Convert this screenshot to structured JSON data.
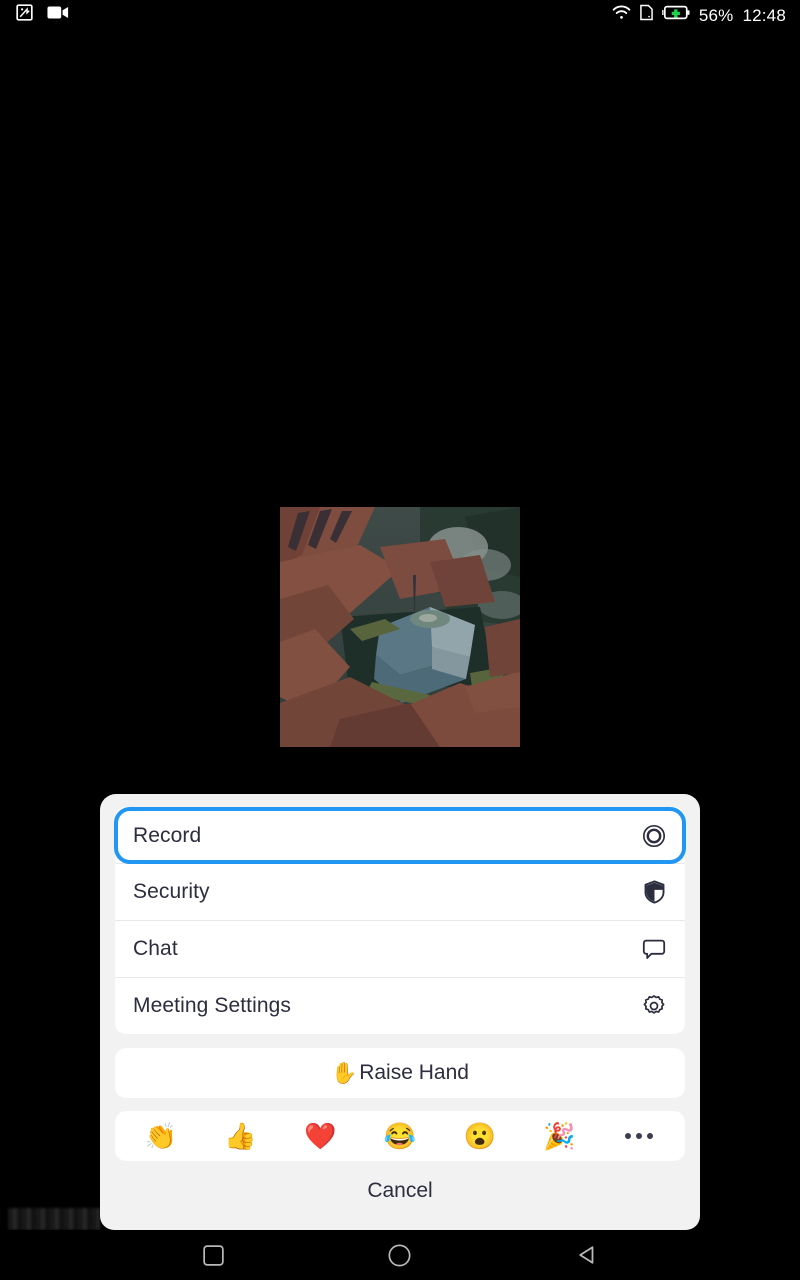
{
  "status_bar": {
    "left_icons": [
      {
        "name": "screenshot-icon",
        "label": "screenshot"
      },
      {
        "name": "video-recorder-icon",
        "label": "video recording"
      }
    ],
    "right_icons": [
      {
        "name": "wifi-icon",
        "label": "wifi"
      },
      {
        "name": "sim-card-icon",
        "label": "sim card"
      },
      {
        "name": "battery-charging-icon",
        "label": "battery charging"
      }
    ],
    "battery_percent": "56%",
    "clock": "12:48",
    "text_color": "#ffffff",
    "background": "#000000"
  },
  "video_tile": {
    "name": "participant-video-thumbnail",
    "description": "painted landscape with red rock cliffs, pine forest and a blue-teal quarry lake"
  },
  "sheet": {
    "background": "#f2f2f2",
    "menu_items": [
      {
        "label": "Record",
        "icon": "record-circle-icon",
        "focused": true
      },
      {
        "label": "Security",
        "icon": "shield-icon",
        "focused": false
      },
      {
        "label": "Chat",
        "icon": "chat-bubble-icon",
        "focused": false
      },
      {
        "label": "Meeting Settings",
        "icon": "gear-icon",
        "focused": false
      }
    ],
    "focus_ring_color": "#2196f3",
    "raise_hand": {
      "emoji": "✋",
      "label": "Raise Hand"
    },
    "reactions": [
      {
        "name": "clap-emoji",
        "glyph": "👏"
      },
      {
        "name": "thumbs-up-emoji",
        "glyph": "👍"
      },
      {
        "name": "heart-emoji",
        "glyph": "❤️"
      },
      {
        "name": "joy-emoji",
        "glyph": "😂"
      },
      {
        "name": "open-mouth-emoji",
        "glyph": "😮"
      },
      {
        "name": "party-popper-emoji",
        "glyph": "🎉"
      }
    ],
    "more_reactions_label": "",
    "cancel_label": "Cancel"
  },
  "nav_bar": {
    "buttons": [
      {
        "name": "recents-button",
        "shape": "square"
      },
      {
        "name": "home-button",
        "shape": "circle"
      },
      {
        "name": "back-button",
        "shape": "triangle"
      }
    ]
  }
}
